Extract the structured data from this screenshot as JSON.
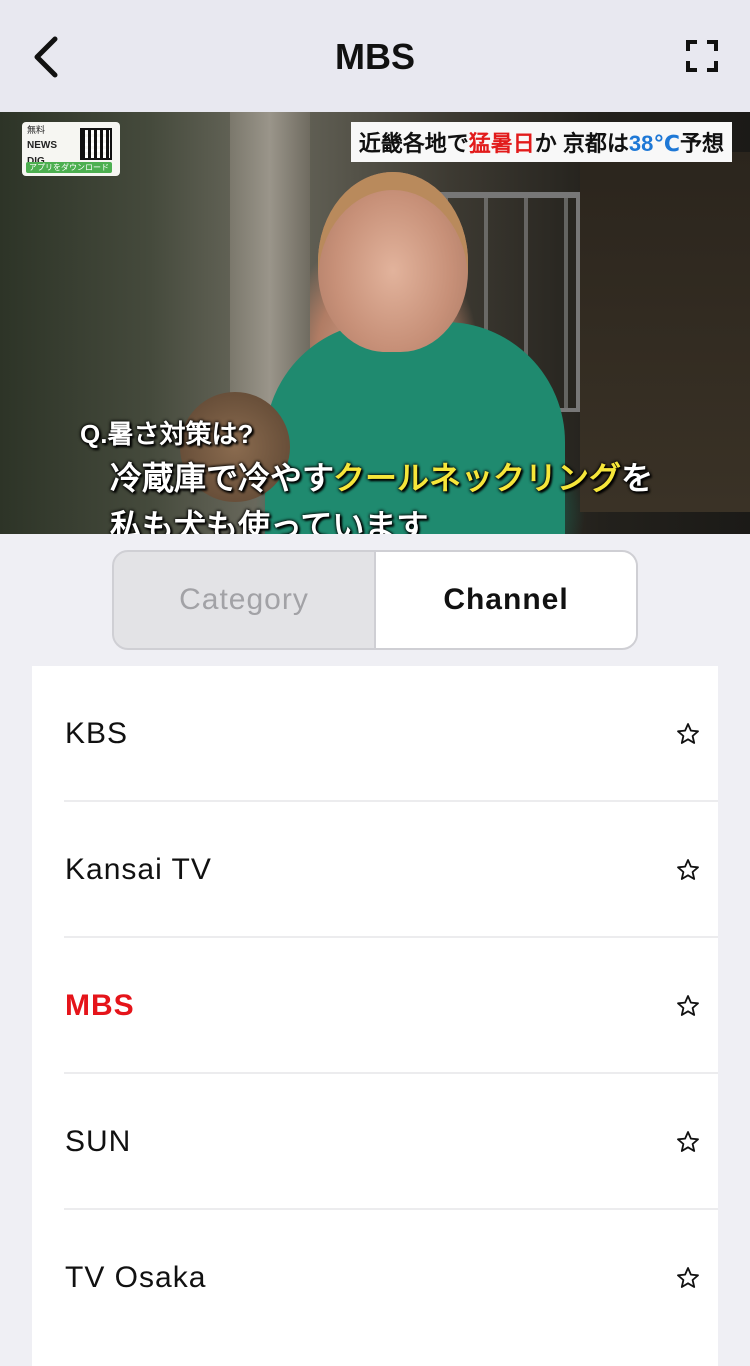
{
  "header": {
    "title": "MBS",
    "back_icon": "chevron-left-icon",
    "fullscreen_icon": "fullscreen-icon"
  },
  "video": {
    "logo": {
      "tag": "無料",
      "line1": "NEWS",
      "line2": "DIG",
      "cta": "アプリをダウンロード"
    },
    "headline": {
      "part1": "近畿各地で",
      "part2_red": "猛暑日",
      "part3": "か 京都は",
      "part4_blue": "38℃",
      "part5": "予想"
    },
    "caption": {
      "question": "Q.暑さ対策は?",
      "line1_white": "冷蔵庫で冷やす",
      "line1_yellow": "クールネックリング",
      "line1_end": "を",
      "line2": "私も犬も使っています"
    }
  },
  "segment": {
    "tabs": [
      {
        "label": "Category",
        "selected": false
      },
      {
        "label": "Channel",
        "selected": true
      }
    ]
  },
  "channels": [
    {
      "name": "KBS",
      "active": false,
      "favorite_icon": "star-outline-icon"
    },
    {
      "name": "Kansai TV",
      "active": false,
      "favorite_icon": "star-outline-icon"
    },
    {
      "name": "MBS",
      "active": true,
      "favorite_icon": "star-outline-icon"
    },
    {
      "name": "SUN",
      "active": false,
      "favorite_icon": "star-outline-icon"
    },
    {
      "name": "TV Osaka",
      "active": false,
      "favorite_icon": "star-outline-icon"
    }
  ],
  "colors": {
    "accent_active": "#e5141a",
    "nav_background": "#e8e8f0",
    "page_background": "#efeff4"
  }
}
